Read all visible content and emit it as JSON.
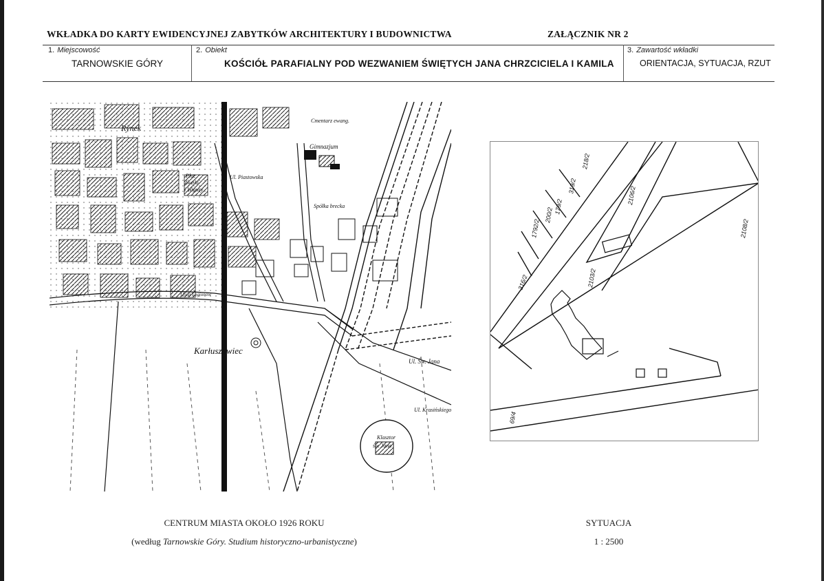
{
  "header": {
    "title": "WKŁADKA DO KARTY EWIDENCYJNEJ ZABYTKÓW ARCHITEKTURY I BUDOWNICTWA",
    "attachment": "ZAŁĄCZNIK NR 2"
  },
  "fields": [
    {
      "num": "1.",
      "label": "Miejscowość",
      "value": "TARNOWSKIE GÓRY"
    },
    {
      "num": "2.",
      "label": "Obiekt",
      "value": "KOŚCIÓŁ PARAFIALNY POD WEZWANIEM ŚWIĘTYCH JANA CHRZCICIELA I KAMILA"
    },
    {
      "num": "3.",
      "label": "Zawartość wkładki",
      "value": "ORIENTACJA, SYTUACJA, RZUT"
    }
  ],
  "city_map": {
    "labels": {
      "rynek": "Rynek",
      "cmentarz": "Cmentarz ewang.",
      "gimnazjum": "Gimnazjum",
      "plac": "Plac",
      "zwirki": "Żwirki",
      "wigury": "i Wigury",
      "ul_piastowska": "Ul. Piastowska",
      "spolka_brecka": "Spółka brecka",
      "karluszowiec": "Karłuszowiec",
      "ul_sw_jana": "Ul. Św. Jana",
      "ul_legionow": "Ulica Legionów",
      "ul_krasinskiego": "Ul. Krasińskiego",
      "klasztor": "Klasztor",
      "sw_jana": "św. Jana"
    }
  },
  "site_map": {
    "parcels": [
      "2106/2",
      "2108/2",
      "2103/2",
      "218/2",
      "319/2",
      "179/2",
      "200/2",
      "1792/2",
      "316/2",
      "69/4"
    ]
  },
  "captions": {
    "left_line1": "CENTRUM MIASTA OKOŁO 1926 ROKU",
    "left_line2_prefix": "(według ",
    "left_line2_title": "Tarnowskie Góry. Studium historyczno-urbanistyczne",
    "left_line2_suffix": ")",
    "right_line1": "SYTUACJA",
    "right_line2": "1 : 2500"
  }
}
